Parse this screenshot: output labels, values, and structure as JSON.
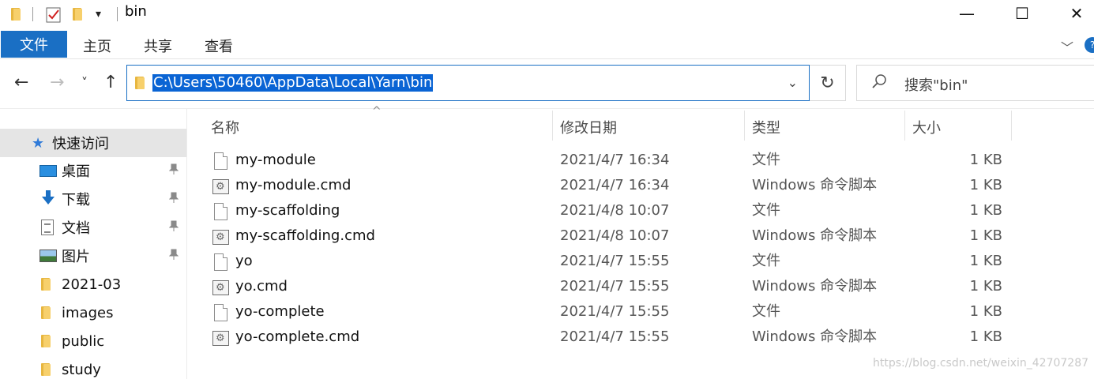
{
  "window": {
    "title": "bin",
    "minimize_glyph": "—",
    "maximize_glyph": "☐",
    "close_glyph": "✕"
  },
  "quick_access_toolbar": {
    "dropdown_glyph": "▾"
  },
  "ribbon": {
    "tabs": [
      "文件",
      "主页",
      "共享",
      "查看"
    ],
    "expand_glyph": "﹀",
    "help_glyph": "?"
  },
  "navigation": {
    "back_glyph": "←",
    "forward_glyph": "→",
    "recent_glyph": "˅",
    "up_glyph": "↑",
    "refresh_glyph": "↻"
  },
  "address_bar": {
    "path": "C:\\Users\\50460\\AppData\\Local\\Yarn\\bin",
    "dropdown_glyph": "⌄"
  },
  "search": {
    "placeholder": "搜索\"bin\"",
    "icon_glyph": "⚲"
  },
  "sidebar": {
    "quick_access": "快速访问",
    "items": [
      {
        "label": "桌面",
        "icon": "desktop-icon",
        "pinned": true
      },
      {
        "label": "下载",
        "icon": "download-icon",
        "pinned": true
      },
      {
        "label": "文档",
        "icon": "documents-icon",
        "pinned": true
      },
      {
        "label": "图片",
        "icon": "pictures-icon",
        "pinned": true
      },
      {
        "label": "2021-03",
        "icon": "folder-icon",
        "pinned": false
      },
      {
        "label": "images",
        "icon": "folder-icon",
        "pinned": false
      },
      {
        "label": "public",
        "icon": "folder-icon",
        "pinned": false
      },
      {
        "label": "study",
        "icon": "folder-icon",
        "pinned": false
      }
    ],
    "pin_glyph": "📌",
    "star_glyph": "★"
  },
  "file_list": {
    "columns": [
      "名称",
      "修改日期",
      "类型",
      "大小"
    ],
    "sort_glyph": "^",
    "files": [
      {
        "name": "my-module",
        "date": "2021/4/7 16:34",
        "type": "文件",
        "size": "1 KB",
        "icon": "file-icon"
      },
      {
        "name": "my-module.cmd",
        "date": "2021/4/7 16:34",
        "type": "Windows 命令脚本",
        "size": "1 KB",
        "icon": "cmd-icon"
      },
      {
        "name": "my-scaffolding",
        "date": "2021/4/8 10:07",
        "type": "文件",
        "size": "1 KB",
        "icon": "file-icon"
      },
      {
        "name": "my-scaffolding.cmd",
        "date": "2021/4/8 10:07",
        "type": "Windows 命令脚本",
        "size": "1 KB",
        "icon": "cmd-icon"
      },
      {
        "name": "yo",
        "date": "2021/4/7 15:55",
        "type": "文件",
        "size": "1 KB",
        "icon": "file-icon"
      },
      {
        "name": "yo.cmd",
        "date": "2021/4/7 15:55",
        "type": "Windows 命令脚本",
        "size": "1 KB",
        "icon": "cmd-icon"
      },
      {
        "name": "yo-complete",
        "date": "2021/4/7 15:55",
        "type": "文件",
        "size": "1 KB",
        "icon": "file-icon"
      },
      {
        "name": "yo-complete.cmd",
        "date": "2021/4/7 15:55",
        "type": "Windows 命令脚本",
        "size": "1 KB",
        "icon": "cmd-icon"
      }
    ]
  },
  "watermark": "https://blog.csdn.net/weixin_42707287",
  "colors": {
    "accent": "#1a6fc4",
    "selection": "#0a64d4",
    "folder": "#f7d06c"
  }
}
